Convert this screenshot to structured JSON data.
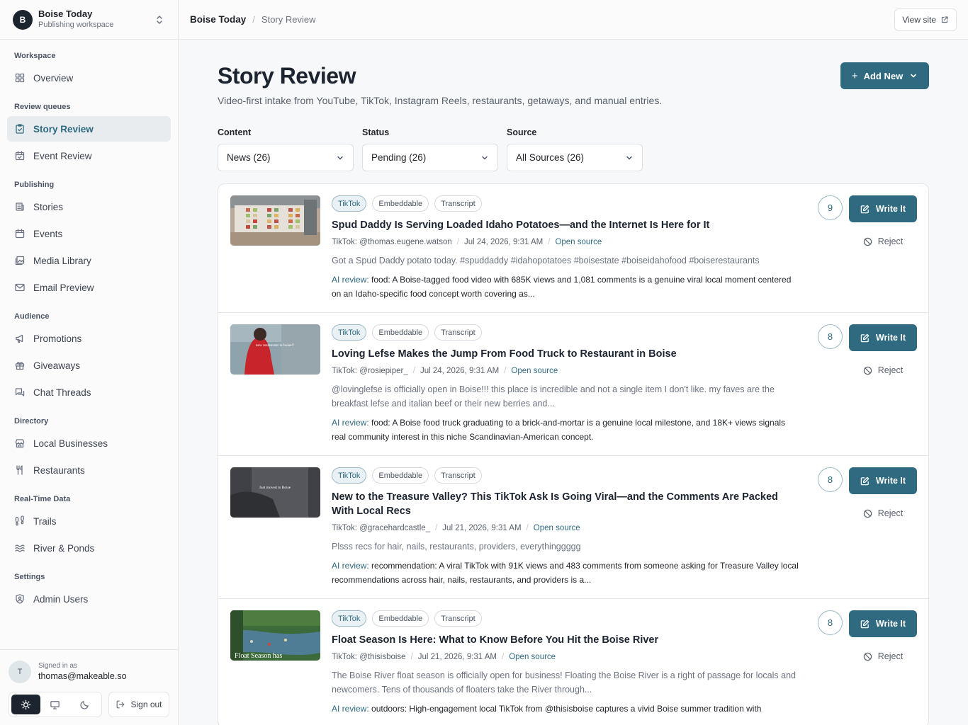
{
  "workspace": {
    "initial": "B",
    "name": "Boise Today",
    "subtitle": "Publishing workspace"
  },
  "breadcrumb": {
    "root": "Boise Today",
    "separator": "/",
    "current": "Story Review"
  },
  "top_actions": {
    "view_site": "View site"
  },
  "sidebar": {
    "sections": [
      {
        "title": "Workspace",
        "items": [
          {
            "label": "Overview",
            "icon": "grid-icon"
          }
        ]
      },
      {
        "title": "Review queues",
        "items": [
          {
            "label": "Story Review",
            "icon": "clipboard-check-icon",
            "active": true
          },
          {
            "label": "Event Review",
            "icon": "calendar-check-icon"
          }
        ]
      },
      {
        "title": "Publishing",
        "items": [
          {
            "label": "Stories",
            "icon": "newspaper-icon"
          },
          {
            "label": "Events",
            "icon": "calendar-icon"
          },
          {
            "label": "Media Library",
            "icon": "images-icon"
          },
          {
            "label": "Email Preview",
            "icon": "mail-icon"
          }
        ]
      },
      {
        "title": "Audience",
        "items": [
          {
            "label": "Promotions",
            "icon": "megaphone-icon"
          },
          {
            "label": "Giveaways",
            "icon": "gift-icon"
          },
          {
            "label": "Chat Threads",
            "icon": "chat-icon"
          }
        ]
      },
      {
        "title": "Directory",
        "items": [
          {
            "label": "Local Businesses",
            "icon": "store-icon"
          },
          {
            "label": "Restaurants",
            "icon": "utensils-icon"
          }
        ]
      },
      {
        "title": "Real-Time Data",
        "items": [
          {
            "label": "Trails",
            "icon": "footprints-icon"
          },
          {
            "label": "River & Ponds",
            "icon": "waves-icon"
          }
        ]
      },
      {
        "title": "Settings",
        "items": [
          {
            "label": "Admin Users",
            "icon": "shield-user-icon"
          }
        ]
      }
    ]
  },
  "user": {
    "initial": "T",
    "signed_in_label": "Signed in as",
    "email": "thomas@makeable.so",
    "sign_out": "Sign out",
    "theme": "light"
  },
  "page": {
    "title": "Story Review",
    "subtitle": "Video-first intake from YouTube, TikTok, Instagram Reels, restaurants, getaways, and manual entries.",
    "add_new": "Add New"
  },
  "filters": [
    {
      "label": "Content",
      "value": "News (26)"
    },
    {
      "label": "Status",
      "value": "Pending (26)"
    },
    {
      "label": "Source",
      "value": "All Sources (26)"
    }
  ],
  "stories": [
    {
      "tags": [
        "TikTok",
        "Embeddable",
        "Transcript"
      ],
      "title": "Spud Daddy Is Serving Loaded Idaho Potatoes—and the Internet Is Here for It",
      "author": "TikTok: @thomas.eugene.watson",
      "date": "Jul 24, 2026, 9:31 AM",
      "source_link": "Open source",
      "excerpt": "Got a Spud Daddy potato today. #spuddaddy #idahopotatoes #boisestate #boiseidahofood #boiserestaurants",
      "ai_label": "AI review:",
      "ai_review": "food: A Boise-tagged food video with 685K views and 1,081 comments is a genuine viral local moment centered on an Idaho-specific food concept worth covering as...",
      "score": "9",
      "write_label": "Write It",
      "reject_label": "Reject",
      "thumb_caption": ""
    },
    {
      "tags": [
        "TikTok",
        "Embeddable",
        "Transcript"
      ],
      "title": "Loving Lefse Makes the Jump From Food Truck to Restaurant in Boise",
      "author": "TikTok: @rosiepiper_",
      "date": "Jul 24, 2026, 9:31 AM",
      "source_link": "Open source",
      "excerpt": "@lovinglefse is officially open in Boise!!! this place is incredible and not a single item I don't like. my faves are the breakfast lefse and italian beef or their new berries and...",
      "ai_label": "AI review:",
      "ai_review": "food: A Boise food truck graduating to a brick-and-mortar is a genuine local milestone, and 18K+ views signals real community interest in this niche Scandinavian-American concept.",
      "score": "8",
      "write_label": "Write It",
      "reject_label": "Reject",
      "thumb_caption": "new restaurant in boise!!"
    },
    {
      "tags": [
        "TikTok",
        "Embeddable",
        "Transcript"
      ],
      "title": "New to the Treasure Valley? This TikTok Ask Is Going Viral—and the Comments Are Packed With Local Recs",
      "author": "TikTok: @gracehardcastle_",
      "date": "Jul 21, 2026, 9:31 AM",
      "source_link": "Open source",
      "excerpt": "Plsss recs for hair, nails, restaurants, providers, everythinggggg",
      "ai_label": "AI review:",
      "ai_review": "recommendation: A viral TikTok with 91K views and 483 comments from someone asking for Treasure Valley local recommendations across hair, nails, restaurants, and providers is a...",
      "score": "8",
      "write_label": "Write It",
      "reject_label": "Reject",
      "thumb_caption": "Just moved to Boise"
    },
    {
      "tags": [
        "TikTok",
        "Embeddable",
        "Transcript"
      ],
      "title": "Float Season Is Here: What to Know Before You Hit the Boise River",
      "author": "TikTok: @thisisboise",
      "date": "Jul 21, 2026, 9:31 AM",
      "source_link": "Open source",
      "excerpt": "The Boise River float season is officially open for business! Floating the Boise River is a right of passage for locals and newcomers. Tens of thousands of floaters take the River through...",
      "ai_label": "AI review:",
      "ai_review": "outdoors: High-engagement local TikTok from @thisisboise captures a vivid Boise summer tradition with",
      "score": "8",
      "write_label": "Write It",
      "reject_label": "Reject",
      "thumb_caption": "Float Season has"
    }
  ],
  "colors": {
    "accent": "#2f6a80",
    "dark": "#1c2430",
    "border": "#e3e5e8"
  }
}
